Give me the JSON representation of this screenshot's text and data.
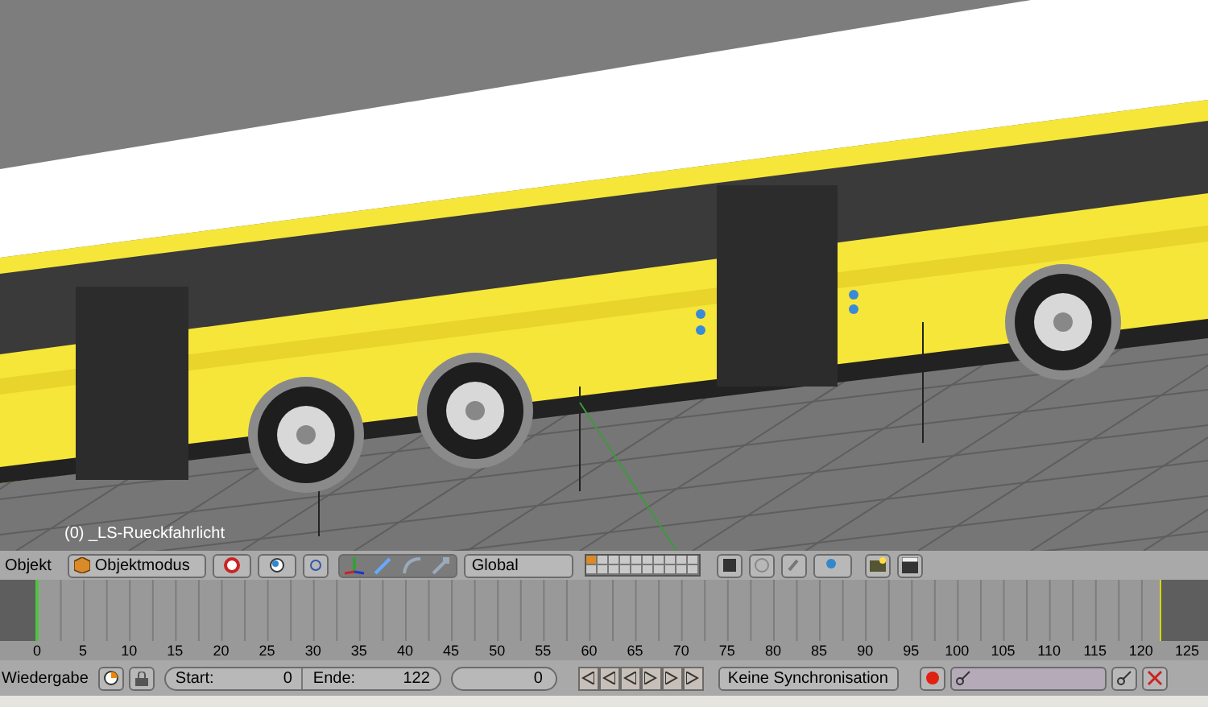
{
  "viewport": {
    "object_label": "(0) _LS-Rueckfahrlicht"
  },
  "header": {
    "menu": "Objekt",
    "mode": "Objektmodus",
    "orientation": "Global"
  },
  "timeline": {
    "ticks": [
      "0",
      "5",
      "10",
      "15",
      "20",
      "25",
      "30",
      "35",
      "40",
      "45",
      "50",
      "55",
      "60",
      "65",
      "70",
      "75",
      "80",
      "85",
      "90",
      "95",
      "100",
      "105",
      "110",
      "115",
      "120",
      "125"
    ]
  },
  "playback": {
    "menu": "Wiedergabe",
    "start_label": "Start:",
    "start": "0",
    "end_label": "Ende:",
    "end": "122",
    "current": "0",
    "sync": "Keine Synchronisation"
  }
}
